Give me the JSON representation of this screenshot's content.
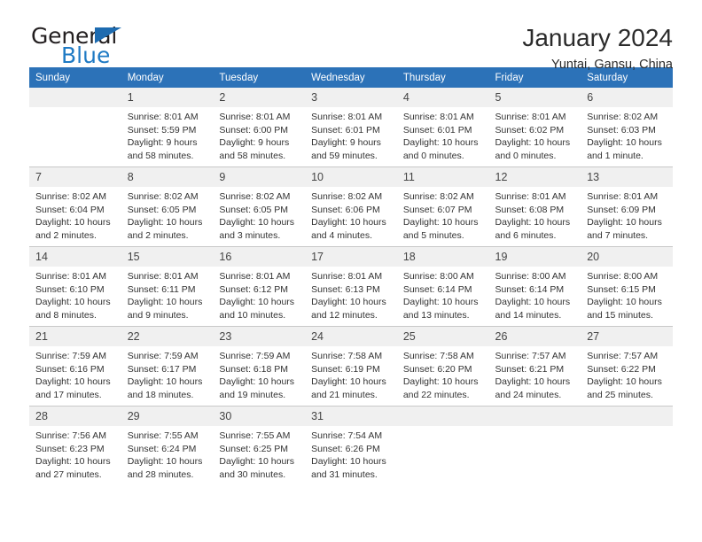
{
  "brand": {
    "name_part1": "General",
    "name_part2": "Blue",
    "flag_icon": "triangle-flag-icon"
  },
  "header": {
    "title": "January 2024",
    "subtitle": "Yuntai, Gansu, China"
  },
  "theme": {
    "header_blue": "#2c72b8",
    "daynum_band": "#f0f0f0",
    "grid_line": "#c8c8c8",
    "logo_blue": "#1f7ac4",
    "text": "#333333"
  },
  "weekday_headers": [
    "Sunday",
    "Monday",
    "Tuesday",
    "Wednesday",
    "Thursday",
    "Friday",
    "Saturday"
  ],
  "weeks": [
    [
      {
        "day": "",
        "empty": true,
        "sunrise": "",
        "sunset": "",
        "daylight_line1": "",
        "daylight_line2": ""
      },
      {
        "day": "1",
        "empty": false,
        "sunrise": "Sunrise: 8:01 AM",
        "sunset": "Sunset: 5:59 PM",
        "daylight_line1": "Daylight: 9 hours",
        "daylight_line2": "and 58 minutes."
      },
      {
        "day": "2",
        "empty": false,
        "sunrise": "Sunrise: 8:01 AM",
        "sunset": "Sunset: 6:00 PM",
        "daylight_line1": "Daylight: 9 hours",
        "daylight_line2": "and 58 minutes."
      },
      {
        "day": "3",
        "empty": false,
        "sunrise": "Sunrise: 8:01 AM",
        "sunset": "Sunset: 6:01 PM",
        "daylight_line1": "Daylight: 9 hours",
        "daylight_line2": "and 59 minutes."
      },
      {
        "day": "4",
        "empty": false,
        "sunrise": "Sunrise: 8:01 AM",
        "sunset": "Sunset: 6:01 PM",
        "daylight_line1": "Daylight: 10 hours",
        "daylight_line2": "and 0 minutes."
      },
      {
        "day": "5",
        "empty": false,
        "sunrise": "Sunrise: 8:01 AM",
        "sunset": "Sunset: 6:02 PM",
        "daylight_line1": "Daylight: 10 hours",
        "daylight_line2": "and 0 minutes."
      },
      {
        "day": "6",
        "empty": false,
        "sunrise": "Sunrise: 8:02 AM",
        "sunset": "Sunset: 6:03 PM",
        "daylight_line1": "Daylight: 10 hours",
        "daylight_line2": "and 1 minute."
      }
    ],
    [
      {
        "day": "7",
        "empty": false,
        "sunrise": "Sunrise: 8:02 AM",
        "sunset": "Sunset: 6:04 PM",
        "daylight_line1": "Daylight: 10 hours",
        "daylight_line2": "and 2 minutes."
      },
      {
        "day": "8",
        "empty": false,
        "sunrise": "Sunrise: 8:02 AM",
        "sunset": "Sunset: 6:05 PM",
        "daylight_line1": "Daylight: 10 hours",
        "daylight_line2": "and 2 minutes."
      },
      {
        "day": "9",
        "empty": false,
        "sunrise": "Sunrise: 8:02 AM",
        "sunset": "Sunset: 6:05 PM",
        "daylight_line1": "Daylight: 10 hours",
        "daylight_line2": "and 3 minutes."
      },
      {
        "day": "10",
        "empty": false,
        "sunrise": "Sunrise: 8:02 AM",
        "sunset": "Sunset: 6:06 PM",
        "daylight_line1": "Daylight: 10 hours",
        "daylight_line2": "and 4 minutes."
      },
      {
        "day": "11",
        "empty": false,
        "sunrise": "Sunrise: 8:02 AM",
        "sunset": "Sunset: 6:07 PM",
        "daylight_line1": "Daylight: 10 hours",
        "daylight_line2": "and 5 minutes."
      },
      {
        "day": "12",
        "empty": false,
        "sunrise": "Sunrise: 8:01 AM",
        "sunset": "Sunset: 6:08 PM",
        "daylight_line1": "Daylight: 10 hours",
        "daylight_line2": "and 6 minutes."
      },
      {
        "day": "13",
        "empty": false,
        "sunrise": "Sunrise: 8:01 AM",
        "sunset": "Sunset: 6:09 PM",
        "daylight_line1": "Daylight: 10 hours",
        "daylight_line2": "and 7 minutes."
      }
    ],
    [
      {
        "day": "14",
        "empty": false,
        "sunrise": "Sunrise: 8:01 AM",
        "sunset": "Sunset: 6:10 PM",
        "daylight_line1": "Daylight: 10 hours",
        "daylight_line2": "and 8 minutes."
      },
      {
        "day": "15",
        "empty": false,
        "sunrise": "Sunrise: 8:01 AM",
        "sunset": "Sunset: 6:11 PM",
        "daylight_line1": "Daylight: 10 hours",
        "daylight_line2": "and 9 minutes."
      },
      {
        "day": "16",
        "empty": false,
        "sunrise": "Sunrise: 8:01 AM",
        "sunset": "Sunset: 6:12 PM",
        "daylight_line1": "Daylight: 10 hours",
        "daylight_line2": "and 10 minutes."
      },
      {
        "day": "17",
        "empty": false,
        "sunrise": "Sunrise: 8:01 AM",
        "sunset": "Sunset: 6:13 PM",
        "daylight_line1": "Daylight: 10 hours",
        "daylight_line2": "and 12 minutes."
      },
      {
        "day": "18",
        "empty": false,
        "sunrise": "Sunrise: 8:00 AM",
        "sunset": "Sunset: 6:14 PM",
        "daylight_line1": "Daylight: 10 hours",
        "daylight_line2": "and 13 minutes."
      },
      {
        "day": "19",
        "empty": false,
        "sunrise": "Sunrise: 8:00 AM",
        "sunset": "Sunset: 6:14 PM",
        "daylight_line1": "Daylight: 10 hours",
        "daylight_line2": "and 14 minutes."
      },
      {
        "day": "20",
        "empty": false,
        "sunrise": "Sunrise: 8:00 AM",
        "sunset": "Sunset: 6:15 PM",
        "daylight_line1": "Daylight: 10 hours",
        "daylight_line2": "and 15 minutes."
      }
    ],
    [
      {
        "day": "21",
        "empty": false,
        "sunrise": "Sunrise: 7:59 AM",
        "sunset": "Sunset: 6:16 PM",
        "daylight_line1": "Daylight: 10 hours",
        "daylight_line2": "and 17 minutes."
      },
      {
        "day": "22",
        "empty": false,
        "sunrise": "Sunrise: 7:59 AM",
        "sunset": "Sunset: 6:17 PM",
        "daylight_line1": "Daylight: 10 hours",
        "daylight_line2": "and 18 minutes."
      },
      {
        "day": "23",
        "empty": false,
        "sunrise": "Sunrise: 7:59 AM",
        "sunset": "Sunset: 6:18 PM",
        "daylight_line1": "Daylight: 10 hours",
        "daylight_line2": "and 19 minutes."
      },
      {
        "day": "24",
        "empty": false,
        "sunrise": "Sunrise: 7:58 AM",
        "sunset": "Sunset: 6:19 PM",
        "daylight_line1": "Daylight: 10 hours",
        "daylight_line2": "and 21 minutes."
      },
      {
        "day": "25",
        "empty": false,
        "sunrise": "Sunrise: 7:58 AM",
        "sunset": "Sunset: 6:20 PM",
        "daylight_line1": "Daylight: 10 hours",
        "daylight_line2": "and 22 minutes."
      },
      {
        "day": "26",
        "empty": false,
        "sunrise": "Sunrise: 7:57 AM",
        "sunset": "Sunset: 6:21 PM",
        "daylight_line1": "Daylight: 10 hours",
        "daylight_line2": "and 24 minutes."
      },
      {
        "day": "27",
        "empty": false,
        "sunrise": "Sunrise: 7:57 AM",
        "sunset": "Sunset: 6:22 PM",
        "daylight_line1": "Daylight: 10 hours",
        "daylight_line2": "and 25 minutes."
      }
    ],
    [
      {
        "day": "28",
        "empty": false,
        "sunrise": "Sunrise: 7:56 AM",
        "sunset": "Sunset: 6:23 PM",
        "daylight_line1": "Daylight: 10 hours",
        "daylight_line2": "and 27 minutes."
      },
      {
        "day": "29",
        "empty": false,
        "sunrise": "Sunrise: 7:55 AM",
        "sunset": "Sunset: 6:24 PM",
        "daylight_line1": "Daylight: 10 hours",
        "daylight_line2": "and 28 minutes."
      },
      {
        "day": "30",
        "empty": false,
        "sunrise": "Sunrise: 7:55 AM",
        "sunset": "Sunset: 6:25 PM",
        "daylight_line1": "Daylight: 10 hours",
        "daylight_line2": "and 30 minutes."
      },
      {
        "day": "31",
        "empty": false,
        "sunrise": "Sunrise: 7:54 AM",
        "sunset": "Sunset: 6:26 PM",
        "daylight_line1": "Daylight: 10 hours",
        "daylight_line2": "and 31 minutes."
      },
      {
        "day": "",
        "empty": true,
        "sunrise": "",
        "sunset": "",
        "daylight_line1": "",
        "daylight_line2": ""
      },
      {
        "day": "",
        "empty": true,
        "sunrise": "",
        "sunset": "",
        "daylight_line1": "",
        "daylight_line2": ""
      },
      {
        "day": "",
        "empty": true,
        "sunrise": "",
        "sunset": "",
        "daylight_line1": "",
        "daylight_line2": ""
      }
    ]
  ]
}
